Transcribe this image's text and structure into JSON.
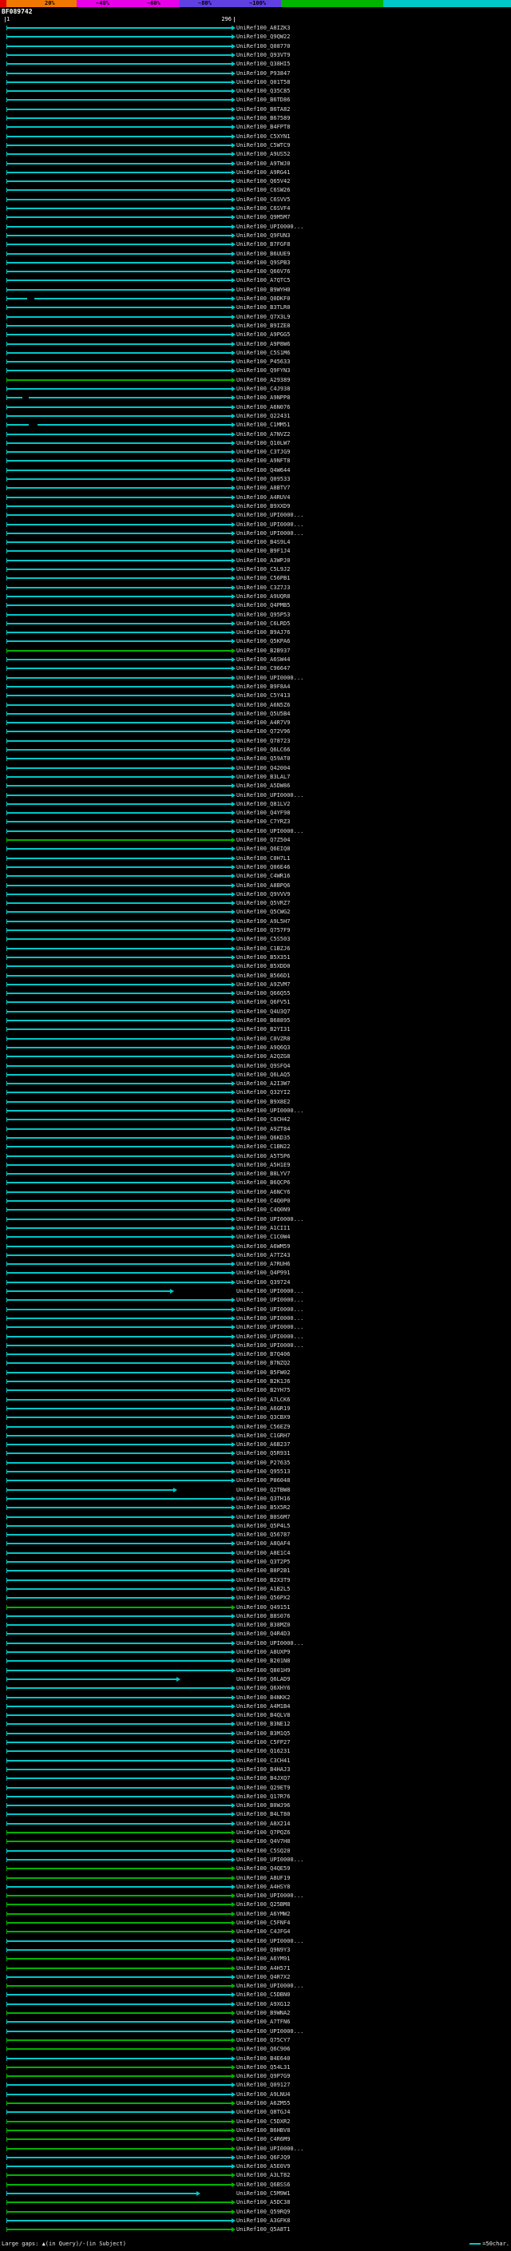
{
  "meta": {
    "title": "BF089742",
    "query_start": "1",
    "query_end": "296"
  },
  "scale": {
    "labels": [
      "20%",
      "~40%",
      "~60%",
      "~80%",
      "~100%"
    ],
    "segments": [
      {
        "color": "#e00000",
        "from": 0.0,
        "to": 0.013
      },
      {
        "color": "#f07800",
        "from": 0.013,
        "to": 0.15
      },
      {
        "color": "#e800e8",
        "from": 0.15,
        "to": 0.35
      },
      {
        "color": "#6040e0",
        "from": 0.35,
        "to": 0.55
      },
      {
        "color": "#00b400",
        "from": 0.55,
        "to": 0.75
      },
      {
        "color": "#00c8c8",
        "from": 0.75,
        "to": 1.0
      }
    ]
  },
  "footer": {
    "left": "Large gaps: ▲(in Query)/-(in Subject)",
    "right": "=50char."
  },
  "chart_data": {
    "type": "alignment-overview",
    "title": "BF089742",
    "query": {
      "id": "BF089742",
      "start": 1,
      "end": 296
    },
    "identity_colors": {
      "cyan": "#00c8c8",
      "green": "#00b400"
    },
    "default_color": "cyan",
    "legend": "line color encodes percent identity; arrows point to alignment end; labels are subject sequence IDs",
    "hits": [
      {
        "label": "UniRef100_A8IZK3"
      },
      {
        "label": "UniRef100_Q9QW22"
      },
      {
        "label": "UniRef100_Q08770"
      },
      {
        "label": "UniRef100_Q93VT9"
      },
      {
        "label": "UniRef100_Q38HI5"
      },
      {
        "label": "UniRef100_P93847"
      },
      {
        "label": "UniRef100_Q01T58"
      },
      {
        "label": "UniRef100_Q35C85"
      },
      {
        "label": "UniRef100_B6TD86"
      },
      {
        "label": "UniRef100_B6TA82"
      },
      {
        "label": "UniRef100_B67589"
      },
      {
        "label": "UniRef100_B4FPT8"
      },
      {
        "label": "UniRef100_C5XYN1"
      },
      {
        "label": "UniRef100_C5WTC9"
      },
      {
        "label": "UniRef100_A9US52"
      },
      {
        "label": "UniRef100_A9TWJ0"
      },
      {
        "label": "UniRef100_A9RG41"
      },
      {
        "label": "UniRef100_Q65V42"
      },
      {
        "label": "UniRef100_C6SW26"
      },
      {
        "label": "UniRef100_C6SVV5"
      },
      {
        "label": "UniRef100_C6SVF4"
      },
      {
        "label": "UniRef100_Q9M5M7"
      },
      {
        "label": "UniRef100_UPI0000..."
      },
      {
        "label": "UniRef100_Q9FUN3"
      },
      {
        "label": "UniRef100_B7FGF8"
      },
      {
        "label": "UniRef100_B6UUE9"
      },
      {
        "label": "UniRef100_Q9SPB3"
      },
      {
        "label": "UniRef100_Q66V76"
      },
      {
        "label": "UniRef100_A7QTC5"
      },
      {
        "label": "UniRef100_B9WYH0"
      },
      {
        "label": "UniRef100_Q0DKF0",
        "segments": [
          [
            1,
            28
          ],
          [
            38,
            296
          ]
        ]
      },
      {
        "label": "UniRef100_B3TLR0"
      },
      {
        "label": "UniRef100_Q7X3L9"
      },
      {
        "label": "UniRef100_B9IZE8"
      },
      {
        "label": "UniRef100_A9PGG5"
      },
      {
        "label": "UniRef100_A9P8W6"
      },
      {
        "label": "UniRef100_C5S1M6"
      },
      {
        "label": "UniRef100_P45633"
      },
      {
        "label": "UniRef100_Q9FYN3"
      },
      {
        "label": "UniRef100_A29389",
        "color": "green"
      },
      {
        "label": "UniRef100_C4J938"
      },
      {
        "label": "UniRef100_A9NPP8",
        "segments": [
          [
            1,
            22
          ],
          [
            30,
            296
          ]
        ]
      },
      {
        "label": "UniRef100_A6N076"
      },
      {
        "label": "UniRef100_Q22431"
      },
      {
        "label": "UniRef100_C1MM51",
        "segments": [
          [
            1,
            30
          ],
          [
            42,
            296
          ]
        ]
      },
      {
        "label": "UniRef100_A7NVZ2"
      },
      {
        "label": "UniRef100_Q10LW7"
      },
      {
        "label": "UniRef100_C3TJG9"
      },
      {
        "label": "UniRef100_A9NFT8"
      },
      {
        "label": "UniRef100_Q4W644"
      },
      {
        "label": "UniRef100_Q09533"
      },
      {
        "label": "UniRef100_A8BTV7"
      },
      {
        "label": "UniRef100_A4RUV4"
      },
      {
        "label": "UniRef100_B9XXD9"
      },
      {
        "label": "UniRef100_UPI0000..."
      },
      {
        "label": "UniRef100_UPI0000..."
      },
      {
        "label": "UniRef100_UPI0000..."
      },
      {
        "label": "UniRef100_B4S9L4"
      },
      {
        "label": "UniRef100_B9F1J4"
      },
      {
        "label": "UniRef100_A3WPJ0"
      },
      {
        "label": "UniRef100_C5L9J2"
      },
      {
        "label": "UniRef100_C56PB1"
      },
      {
        "label": "UniRef100_C3Z7J3"
      },
      {
        "label": "UniRef100_A9UQR8"
      },
      {
        "label": "UniRef100_Q4PMB5"
      },
      {
        "label": "UniRef100_Q95P53"
      },
      {
        "label": "UniRef100_C6LRD5"
      },
      {
        "label": "UniRef100_B9AJ76"
      },
      {
        "label": "UniRef100_Q5KPA6"
      },
      {
        "label": "UniRef100_B2B937",
        "color": "green"
      },
      {
        "label": "UniRef100_A6SW44"
      },
      {
        "label": "UniRef100_C96647"
      },
      {
        "label": "UniRef100_UPI0000..."
      },
      {
        "label": "UniRef100_B9F8A4"
      },
      {
        "label": "UniRef100_C5Y413"
      },
      {
        "label": "UniRef100_A6N5Z6"
      },
      {
        "label": "UniRef100_Q5U5B4"
      },
      {
        "label": "UniRef100_A4R7V9"
      },
      {
        "label": "UniRef100_Q72V96"
      },
      {
        "label": "UniRef100_Q78723"
      },
      {
        "label": "UniRef100_Q6LC66"
      },
      {
        "label": "UniRef100_Q59AT0"
      },
      {
        "label": "UniRef100_Q42004"
      },
      {
        "label": "UniRef100_B3LAL7"
      },
      {
        "label": "UniRef100_A5DW86"
      },
      {
        "label": "UniRef100_UPI0000..."
      },
      {
        "label": "UniRef100_Q81LV2"
      },
      {
        "label": "UniRef100_Q4YF98"
      },
      {
        "label": "UniRef100_C7YRZ3"
      },
      {
        "label": "UniRef100_UPI0000..."
      },
      {
        "label": "UniRef100_Q7Z504",
        "color": "green"
      },
      {
        "label": "UniRef100_Q6EIQ8"
      },
      {
        "label": "UniRef100_C0H7L1"
      },
      {
        "label": "UniRef100_Q06E46"
      },
      {
        "label": "UniRef100_C4WR16"
      },
      {
        "label": "UniRef100_A8BPQ6"
      },
      {
        "label": "UniRef100_Q9VVV9"
      },
      {
        "label": "UniRef100_Q5VRZ7"
      },
      {
        "label": "UniRef100_Q5CWG2"
      },
      {
        "label": "UniRef100_A9L5H7"
      },
      {
        "label": "UniRef100_Q757F9"
      },
      {
        "label": "UniRef100_C5S503"
      },
      {
        "label": "UniRef100_C1BZJ6"
      },
      {
        "label": "UniRef100_B5X351"
      },
      {
        "label": "UniRef100_B5XDD0"
      },
      {
        "label": "UniRef100_B566D1"
      },
      {
        "label": "UniRef100_A9ZVM7"
      },
      {
        "label": "UniRef100_Q66Q55"
      },
      {
        "label": "UniRef100_Q6FV51"
      },
      {
        "label": "UniRef100_Q4U3Q7"
      },
      {
        "label": "UniRef100_B68895"
      },
      {
        "label": "UniRef100_B2YI31"
      },
      {
        "label": "UniRef100_C0VZR8"
      },
      {
        "label": "UniRef100_A9Q6Q3"
      },
      {
        "label": "UniRef100_A2QZG8"
      },
      {
        "label": "UniRef100_Q9SFQ4"
      },
      {
        "label": "UniRef100_Q6LAQ5"
      },
      {
        "label": "UniRef100_A2I3W7"
      },
      {
        "label": "UniRef100_Q32YI2"
      },
      {
        "label": "UniRef100_B9X8E2"
      },
      {
        "label": "UniRef100_UPI0000..."
      },
      {
        "label": "UniRef100_C0CH42"
      },
      {
        "label": "UniRef100_A9ZT84"
      },
      {
        "label": "UniRef100_Q6KD35"
      },
      {
        "label": "UniRef100_C1BN22"
      },
      {
        "label": "UniRef100_A5T5P6"
      },
      {
        "label": "UniRef100_A5H1E9"
      },
      {
        "label": "UniRef100_B8LYV7"
      },
      {
        "label": "UniRef100_B6QCP6"
      },
      {
        "label": "UniRef100_A6NCY6"
      },
      {
        "label": "UniRef100_C4Q0P0"
      },
      {
        "label": "UniRef100_C4Q0N9"
      },
      {
        "label": "UniRef100_UPI0000..."
      },
      {
        "label": "UniRef100_A1CII1"
      },
      {
        "label": "UniRef100_C1C0W4"
      },
      {
        "label": "UniRef100_A6WM59"
      },
      {
        "label": "UniRef100_A7TZ43"
      },
      {
        "label": "UniRef100_A7RUH6"
      },
      {
        "label": "UniRef100_Q4P991"
      },
      {
        "label": "UniRef100_Q39724"
      },
      {
        "label": "UniRef100_UPI0000...",
        "segments": [
          [
            1,
            215
          ]
        ]
      },
      {
        "label": "UniRef100_UPI0000..."
      },
      {
        "label": "UniRef100_UPI0000..."
      },
      {
        "label": "UniRef100_UPI0000..."
      },
      {
        "label": "UniRef100_UPI0000..."
      },
      {
        "label": "UniRef100_UPI0000..."
      },
      {
        "label": "UniRef100_UPI0000..."
      },
      {
        "label": "UniRef100_B7Q406"
      },
      {
        "label": "UniRef100_B7NZQ2"
      },
      {
        "label": "UniRef100_B5FW02"
      },
      {
        "label": "UniRef100_B2K1J6"
      },
      {
        "label": "UniRef100_B2YH75"
      },
      {
        "label": "UniRef100_A7LCK6"
      },
      {
        "label": "UniRef100_A6GR19"
      },
      {
        "label": "UniRef100_Q3CBX9"
      },
      {
        "label": "UniRef100_C56EZ9"
      },
      {
        "label": "UniRef100_C1GRH7"
      },
      {
        "label": "UniRef100_A6B237"
      },
      {
        "label": "UniRef100_Q5R931"
      },
      {
        "label": "UniRef100_P27635"
      },
      {
        "label": "UniRef100_Q95513"
      },
      {
        "label": "UniRef100_P86048"
      },
      {
        "label": "UniRef100_Q2TBW8",
        "segments": [
          [
            1,
            220
          ]
        ]
      },
      {
        "label": "UniRef100_Q3TH16"
      },
      {
        "label": "UniRef100_B5X5R2"
      },
      {
        "label": "UniRef100_B0S6M7"
      },
      {
        "label": "UniRef100_Q5P4L5"
      },
      {
        "label": "UniRef100_Q56787"
      },
      {
        "label": "UniRef100_A8QAF4"
      },
      {
        "label": "UniRef100_A8E1C4"
      },
      {
        "label": "UniRef100_Q3T2P5"
      },
      {
        "label": "UniRef100_B8P2B1"
      },
      {
        "label": "UniRef100_B2X3T9"
      },
      {
        "label": "UniRef100_A1B2L5"
      },
      {
        "label": "UniRef100_Q56PX2"
      },
      {
        "label": "UniRef100_Q49151",
        "color": "green"
      },
      {
        "label": "UniRef100_B8S076"
      },
      {
        "label": "UniRef100_B38MZ0"
      },
      {
        "label": "UniRef100_Q4R4D3"
      },
      {
        "label": "UniRef100_UPI0000..."
      },
      {
        "label": "UniRef100_A8UXP9"
      },
      {
        "label": "UniRef100_B201N8"
      },
      {
        "label": "UniRef100_Q801H9"
      },
      {
        "label": "UniRef100_Q6LAD9",
        "segments": [
          [
            1,
            224
          ]
        ]
      },
      {
        "label": "UniRef100_Q6XHY6"
      },
      {
        "label": "UniRef100_B4NKK2"
      },
      {
        "label": "UniRef100_A4M1B4"
      },
      {
        "label": "UniRef100_B4QLV8"
      },
      {
        "label": "UniRef100_B3NE12"
      },
      {
        "label": "UniRef100_B3M1Q5"
      },
      {
        "label": "UniRef100_C5FP27"
      },
      {
        "label": "UniRef100_Q16231"
      },
      {
        "label": "UniRef100_C3CH41"
      },
      {
        "label": "UniRef100_B4HAJ3"
      },
      {
        "label": "UniRef100_B4JXQ7"
      },
      {
        "label": "UniRef100_Q29ET9"
      },
      {
        "label": "UniRef100_Q17R76"
      },
      {
        "label": "UniRef100_B0WJ96"
      },
      {
        "label": "UniRef100_B4LT80"
      },
      {
        "label": "UniRef100_A8X214"
      },
      {
        "label": "UniRef100_Q7PQZ6",
        "color": "green"
      },
      {
        "label": "UniRef100_Q4V7H8",
        "color": "green"
      },
      {
        "label": "UniRef100_C5SQ20"
      },
      {
        "label": "UniRef100_UPI0000..."
      },
      {
        "label": "UniRef100_Q4QE59",
        "color": "green"
      },
      {
        "label": "UniRef100_A8UF19",
        "color": "green"
      },
      {
        "label": "UniRef100_A4HSY8"
      },
      {
        "label": "UniRef100_UPI0000...",
        "color": "green"
      },
      {
        "label": "UniRef100_Q25BM8",
        "color": "green"
      },
      {
        "label": "UniRef100_A6YMW2",
        "color": "green"
      },
      {
        "label": "UniRef100_C5FNF4",
        "color": "green"
      },
      {
        "label": "UniRef100_C4JFG4",
        "color": "green"
      },
      {
        "label": "UniRef100_UPI0000..."
      },
      {
        "label": "UniRef100_Q9N9Y3"
      },
      {
        "label": "UniRef100_A6YM91",
        "color": "green"
      },
      {
        "label": "UniRef100_A4H571",
        "color": "green"
      },
      {
        "label": "UniRef100_Q4R7X2"
      },
      {
        "label": "UniRef100_UPI0000...",
        "color": "green"
      },
      {
        "label": "UniRef100_C5DBN0"
      },
      {
        "label": "UniRef100_A9XG12"
      },
      {
        "label": "UniRef100_B9WNA2",
        "color": "green"
      },
      {
        "label": "UniRef100_A7TFN6"
      },
      {
        "label": "UniRef100_UPI0000..."
      },
      {
        "label": "UniRef100_Q75CY7",
        "color": "green"
      },
      {
        "label": "UniRef100_Q6C906",
        "color": "green"
      },
      {
        "label": "UniRef100_B4E640"
      },
      {
        "label": "UniRef100_Q54L31",
        "color": "green"
      },
      {
        "label": "UniRef100_Q9P7G9",
        "color": "green"
      },
      {
        "label": "UniRef100_Q09127"
      },
      {
        "label": "UniRef100_A9LNU4"
      },
      {
        "label": "UniRef100_A6ZM55",
        "color": "green"
      },
      {
        "label": "UniRef100_Q8TGJ4"
      },
      {
        "label": "UniRef100_C5DXR2",
        "color": "green"
      },
      {
        "label": "UniRef100_B6HBV8",
        "color": "green"
      },
      {
        "label": "UniRef100_C4R6M9",
        "color": "green"
      },
      {
        "label": "UniRef100_UPI0000...",
        "color": "green"
      },
      {
        "label": "UniRef100_Q6FJQ9"
      },
      {
        "label": "UniRef100_A5E0V9"
      },
      {
        "label": "UniRef100_A3LT82",
        "color": "green"
      },
      {
        "label": "UniRef100_Q6BSS6",
        "color": "green"
      },
      {
        "label": "UniRef100_C5M9W1",
        "segments": [
          [
            1,
            250
          ]
        ]
      },
      {
        "label": "UniRef100_A5DC38",
        "color": "green"
      },
      {
        "label": "UniRef100_Q59RQ9",
        "color": "green"
      },
      {
        "label": "UniRef100_A3GFK8"
      },
      {
        "label": "UniRef100_Q5A8T1",
        "color": "green"
      }
    ]
  }
}
